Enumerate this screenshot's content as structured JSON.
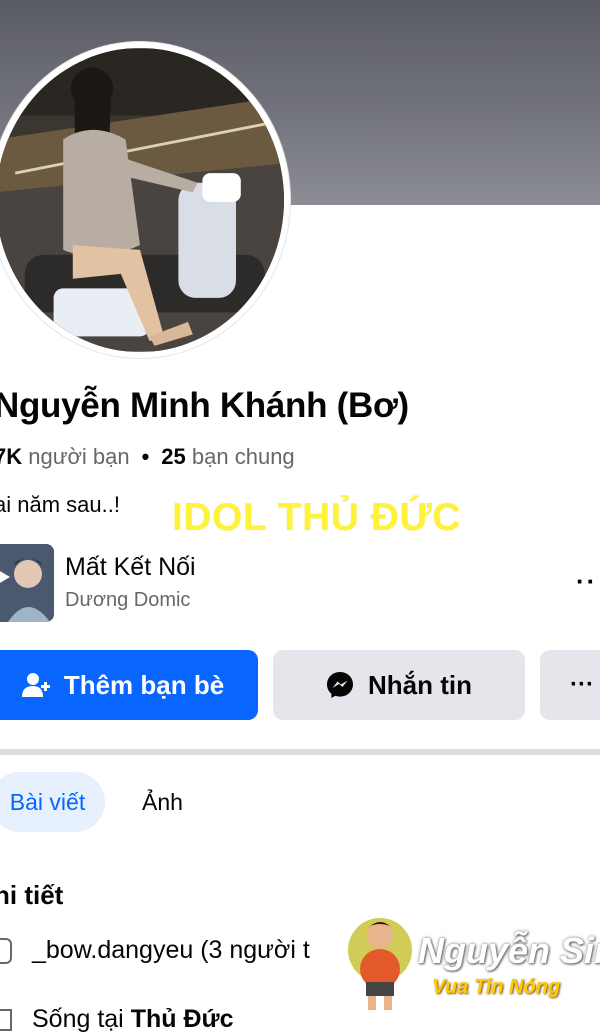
{
  "profile": {
    "name": "Nguyễn Minh Khánh (Bơ)",
    "friends_count": "7K",
    "friends_label": "người bạn",
    "mutual_count": "25",
    "mutual_label": "bạn chung",
    "bio": "ai năm sau..!"
  },
  "overlay_text": "IDOL THỦ ĐỨC",
  "music": {
    "title": "Mất Kết Nối",
    "artist": "Dương Domic"
  },
  "actions": {
    "add_friend_label": "Thêm bạn bè",
    "message_label": "Nhắn tin",
    "more_label": "···"
  },
  "tabs": [
    {
      "label": "Bài viết",
      "active": true
    },
    {
      "label": "Ảnh",
      "active": false
    }
  ],
  "details": {
    "title": "hi tiết",
    "instagram_text": "_bow.dangyeu (3 người t",
    "lives_prefix": "Sống tại",
    "lives_place": "Thủ Đức"
  },
  "watermark": {
    "name": "Nguyễn Sin",
    "subtitle": "Vua Tin Nóng"
  },
  "colors": {
    "primary": "#0866ff",
    "overlay": "#fff23a",
    "secondary_button": "#e4e6eb"
  }
}
